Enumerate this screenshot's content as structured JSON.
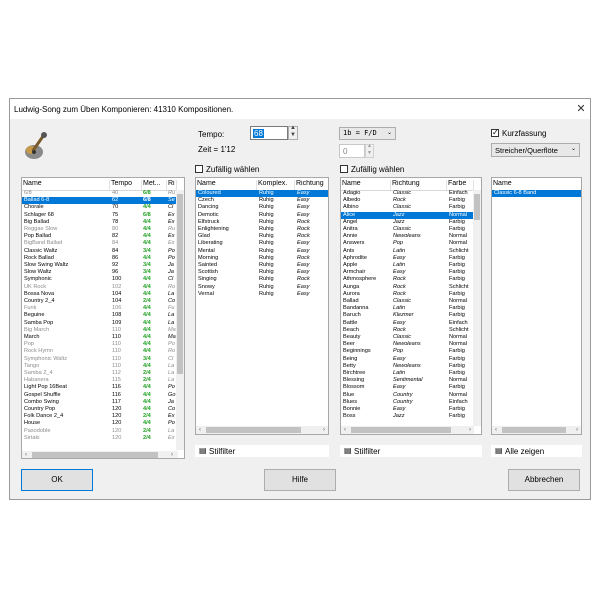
{
  "window": {
    "title": "Ludwig-Song zum Üben Komponieren: 41310 Kompositionen."
  },
  "icons": {
    "app": "guitar-icon",
    "close": "close-icon",
    "filter": "filter-icon"
  },
  "tempo": {
    "label": "Tempo:",
    "value": "68",
    "time_label": "Zeit = 1'12"
  },
  "meter_dropdown": {
    "value": "1b = F/D"
  },
  "number_spin": {
    "value": "0"
  },
  "kurzfassung": {
    "label": "Kurzfassung",
    "checked": true
  },
  "instrument_combo": {
    "value": "Streicher/Querflöte"
  },
  "zufaellig1": {
    "label": "Zufällig wählen"
  },
  "zufaellig2": {
    "label": "Zufällig wählen"
  },
  "styles": {
    "headers": [
      "Name",
      "Tempo",
      "Met...",
      "Ri"
    ],
    "rows": [
      [
        "6/8",
        "40",
        "6/8",
        "Ru",
        "grey"
      ],
      [
        "Ballad 6-8",
        "62",
        "6/8",
        "Se",
        "sel"
      ],
      [
        "Chorale",
        "70",
        "4/4",
        "Cl",
        ""
      ],
      [
        "Schlager 68",
        "75",
        "6/8",
        "Ex",
        ""
      ],
      [
        "Big Ballad",
        "78",
        "4/4",
        "Ex",
        ""
      ],
      [
        "Reggae Slow",
        "80",
        "4/4",
        "Ru",
        "grey"
      ],
      [
        "Pop Ballad",
        "82",
        "4/4",
        "Ex",
        ""
      ],
      [
        "BigBand Ballad",
        "84",
        "4/4",
        "Ex",
        "grey"
      ],
      [
        "Classic Waltz",
        "84",
        "3/4",
        "Po",
        ""
      ],
      [
        "Rock Ballad",
        "86",
        "4/4",
        "Po",
        ""
      ],
      [
        "Slow Swing Waltz",
        "92",
        "3/4",
        "Ja",
        ""
      ],
      [
        "Slow Waltz",
        "96",
        "3/4",
        "Ja",
        ""
      ],
      [
        "Symphonic",
        "100",
        "4/4",
        "Cl",
        ""
      ],
      [
        "UK Rock",
        "102",
        "4/4",
        "Ro",
        "grey"
      ],
      [
        "Bossa Nova",
        "104",
        "4/4",
        "La",
        ""
      ],
      [
        "Country 2_4",
        "104",
        "2/4",
        "Co",
        ""
      ],
      [
        "Funk",
        "106",
        "4/4",
        "Fu",
        "grey"
      ],
      [
        "Beguine",
        "108",
        "4/4",
        "La",
        ""
      ],
      [
        "Samba Pop",
        "109",
        "4/4",
        "La",
        ""
      ],
      [
        "Big March",
        "110",
        "4/4",
        "Ma",
        "grey"
      ],
      [
        "March",
        "110",
        "4/4",
        "Ma",
        ""
      ],
      [
        "Pop",
        "110",
        "4/4",
        "Po",
        "grey"
      ],
      [
        "Rock Hymn",
        "110",
        "4/4",
        "Ro",
        "grey"
      ],
      [
        "Symphonic Waltz",
        "110",
        "3/4",
        "Cl",
        "grey"
      ],
      [
        "Tango",
        "110",
        "4/4",
        "La",
        "grey"
      ],
      [
        "Samba 2_4",
        "112",
        "2/4",
        "La",
        "grey"
      ],
      [
        "Habanera",
        "115",
        "2/4",
        "La",
        "grey"
      ],
      [
        "Light Pop 16Beat",
        "116",
        "4/4",
        "Po",
        ""
      ],
      [
        "Gospel Shuffle",
        "116",
        "4/4",
        "Go",
        ""
      ],
      [
        "Combo Swing",
        "117",
        "4/4",
        "Ja",
        ""
      ],
      [
        "Country Pop",
        "120",
        "4/4",
        "Co",
        ""
      ],
      [
        "Folk Dance 2_4",
        "120",
        "2/4",
        "Ex",
        ""
      ],
      [
        "House",
        "120",
        "4/4",
        "Po",
        ""
      ],
      [
        "Pasodoble",
        "120",
        "2/4",
        "La",
        "grey"
      ],
      [
        "Sirtaki",
        "120",
        "2/4",
        "Ex",
        "grey"
      ]
    ]
  },
  "moods": {
    "headers": [
      "Name",
      "Komplex.",
      "Richtung"
    ],
    "rows": [
      [
        "Coloured",
        "Ruhig",
        "Easy",
        "sel"
      ],
      [
        "Czech",
        "Ruhig",
        "Easy",
        ""
      ],
      [
        "Dancing",
        "Ruhig",
        "Easy",
        ""
      ],
      [
        "Demotic",
        "Ruhig",
        "Easy",
        ""
      ],
      [
        "Elfstruck",
        "Ruhig",
        "Rock",
        ""
      ],
      [
        "Enlightening",
        "Ruhig",
        "Rock",
        ""
      ],
      [
        "Glad",
        "Ruhig",
        "Rock",
        ""
      ],
      [
        "Liberating",
        "Ruhig",
        "Easy",
        ""
      ],
      [
        "Mental",
        "Ruhig",
        "Easy",
        ""
      ],
      [
        "Morning",
        "Ruhig",
        "Rock",
        ""
      ],
      [
        "Sainted",
        "Ruhig",
        "Easy",
        ""
      ],
      [
        "Scottish",
        "Ruhig",
        "Easy",
        ""
      ],
      [
        "Singing",
        "Ruhig",
        "Rock",
        ""
      ],
      [
        "Snowy",
        "Ruhig",
        "Easy",
        ""
      ],
      [
        "Vernal",
        "Ruhig",
        "Easy",
        ""
      ]
    ],
    "filter_label": "Stilfilter"
  },
  "melodies": {
    "headers": [
      "Name",
      "Richtung",
      "Farbe"
    ],
    "rows": [
      [
        "Adagio",
        "Classic",
        "Einfach",
        ""
      ],
      [
        "Albedo",
        "Rock",
        "Farbig",
        ""
      ],
      [
        "Albino",
        "Classic",
        "Farbig",
        ""
      ],
      [
        "Alice",
        "Jazz",
        "Normal",
        "sel"
      ],
      [
        "Angel",
        "Jazz",
        "Farbig",
        ""
      ],
      [
        "Anitra",
        "Classic",
        "Farbig",
        ""
      ],
      [
        "Annie",
        "Newoleans",
        "Normal",
        ""
      ],
      [
        "Answers",
        "Pop",
        "Normal",
        ""
      ],
      [
        "Ants",
        "Latin",
        "Schlicht",
        ""
      ],
      [
        "Aphrodite",
        "Easy",
        "Farbig",
        ""
      ],
      [
        "Apple",
        "Latin",
        "Farbig",
        ""
      ],
      [
        "Armchair",
        "Easy",
        "Farbig",
        ""
      ],
      [
        "Athmosphere",
        "Rock",
        "Farbig",
        ""
      ],
      [
        "Aunga",
        "Rock",
        "Schlicht",
        ""
      ],
      [
        "Aurora",
        "Rock",
        "Farbig",
        ""
      ],
      [
        "Ballad",
        "Classic",
        "Normal",
        ""
      ],
      [
        "Bandanna",
        "Latin",
        "Farbig",
        ""
      ],
      [
        "Baruch",
        "Klezmer",
        "Farbig",
        ""
      ],
      [
        "Battle",
        "Easy",
        "Einfach",
        ""
      ],
      [
        "Beach",
        "Rock",
        "Schlicht",
        ""
      ],
      [
        "Beauty",
        "Classic",
        "Normal",
        ""
      ],
      [
        "Beer",
        "Newoleans",
        "Normal",
        ""
      ],
      [
        "Beginnings",
        "Pop",
        "Farbig",
        ""
      ],
      [
        "Being",
        "Easy",
        "Farbig",
        ""
      ],
      [
        "Betty",
        "Newoleans",
        "Farbig",
        ""
      ],
      [
        "Birchtree",
        "Latin",
        "Farbig",
        ""
      ],
      [
        "Blessing",
        "Sentimental",
        "Normal",
        ""
      ],
      [
        "Blossom",
        "Easy",
        "Farbig",
        ""
      ],
      [
        "Blue",
        "Country",
        "Normal",
        ""
      ],
      [
        "Blues",
        "Country",
        "Einfach",
        ""
      ],
      [
        "Bonnie",
        "Easy",
        "Farbig",
        ""
      ],
      [
        "Boss",
        "Jazz",
        "Farbig",
        ""
      ]
    ],
    "filter_label": "Stilfilter"
  },
  "instruments": {
    "headers": [
      "Name"
    ],
    "rows": [
      [
        "Classic 6-8 Band",
        "sel"
      ]
    ],
    "show_all_label": "Alle zeigen"
  },
  "buttons": {
    "ok": "OK",
    "help": "Hilfe",
    "cancel": "Abbrechen"
  }
}
